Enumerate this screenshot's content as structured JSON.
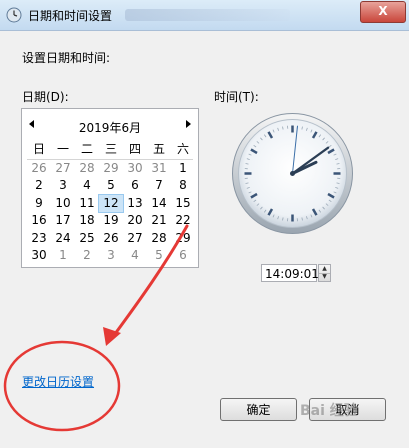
{
  "window": {
    "title": "日期和时间设置",
    "close_label": "X"
  },
  "dialog": {
    "heading": "设置日期和时间:",
    "date_label": "日期(D):",
    "time_label": "时间(T):",
    "change_calendar_link": "更改日历设置",
    "ok_label": "确定",
    "cancel_label": "取消"
  },
  "calendar": {
    "month_title": "2019年6月",
    "prev_icon": "◀",
    "next_icon": "▶",
    "weekdays": [
      "日",
      "一",
      "二",
      "三",
      "四",
      "五",
      "六"
    ],
    "weeks": [
      [
        "26",
        "27",
        "28",
        "29",
        "30",
        "31",
        "1"
      ],
      [
        "2",
        "3",
        "4",
        "5",
        "6",
        "7",
        "8"
      ],
      [
        "9",
        "10",
        "11",
        "12",
        "13",
        "14",
        "15"
      ],
      [
        "16",
        "17",
        "18",
        "19",
        "20",
        "21",
        "22"
      ],
      [
        "23",
        "24",
        "25",
        "26",
        "27",
        "28",
        "29"
      ],
      [
        "30",
        "1",
        "2",
        "3",
        "4",
        "5",
        "6"
      ]
    ],
    "selected_day": "12"
  },
  "clock": {
    "hour": 14,
    "minute": 9,
    "second": 1
  },
  "time_value": "14:09:01",
  "watermark": "Bai 经验",
  "colors": {
    "link": "#0066cc",
    "annotation": "#e53935",
    "selection": "#cce4f7"
  }
}
